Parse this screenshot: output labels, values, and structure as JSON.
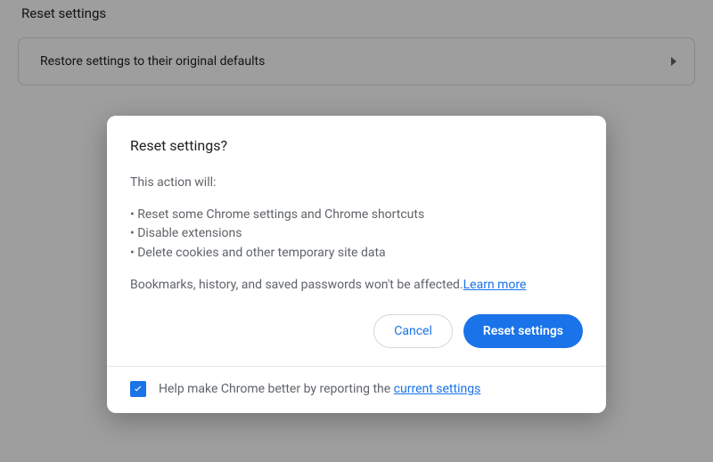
{
  "page": {
    "section_title": "Reset settings",
    "row_label": "Restore settings to their original defaults"
  },
  "dialog": {
    "title": "Reset settings?",
    "lead": "This action will:",
    "bullets": [
      "Reset some Chrome settings and Chrome shortcuts",
      "Disable extensions",
      "Delete cookies and other temporary site data"
    ],
    "footnote_prefix": "Bookmarks, history, and saved passwords won't be affected.",
    "learn_more": "Learn more",
    "cancel_label": "Cancel",
    "confirm_label": "Reset settings",
    "footer_checked": true,
    "footer_text_prefix": "Help make Chrome better by reporting the ",
    "footer_link": "current settings"
  }
}
